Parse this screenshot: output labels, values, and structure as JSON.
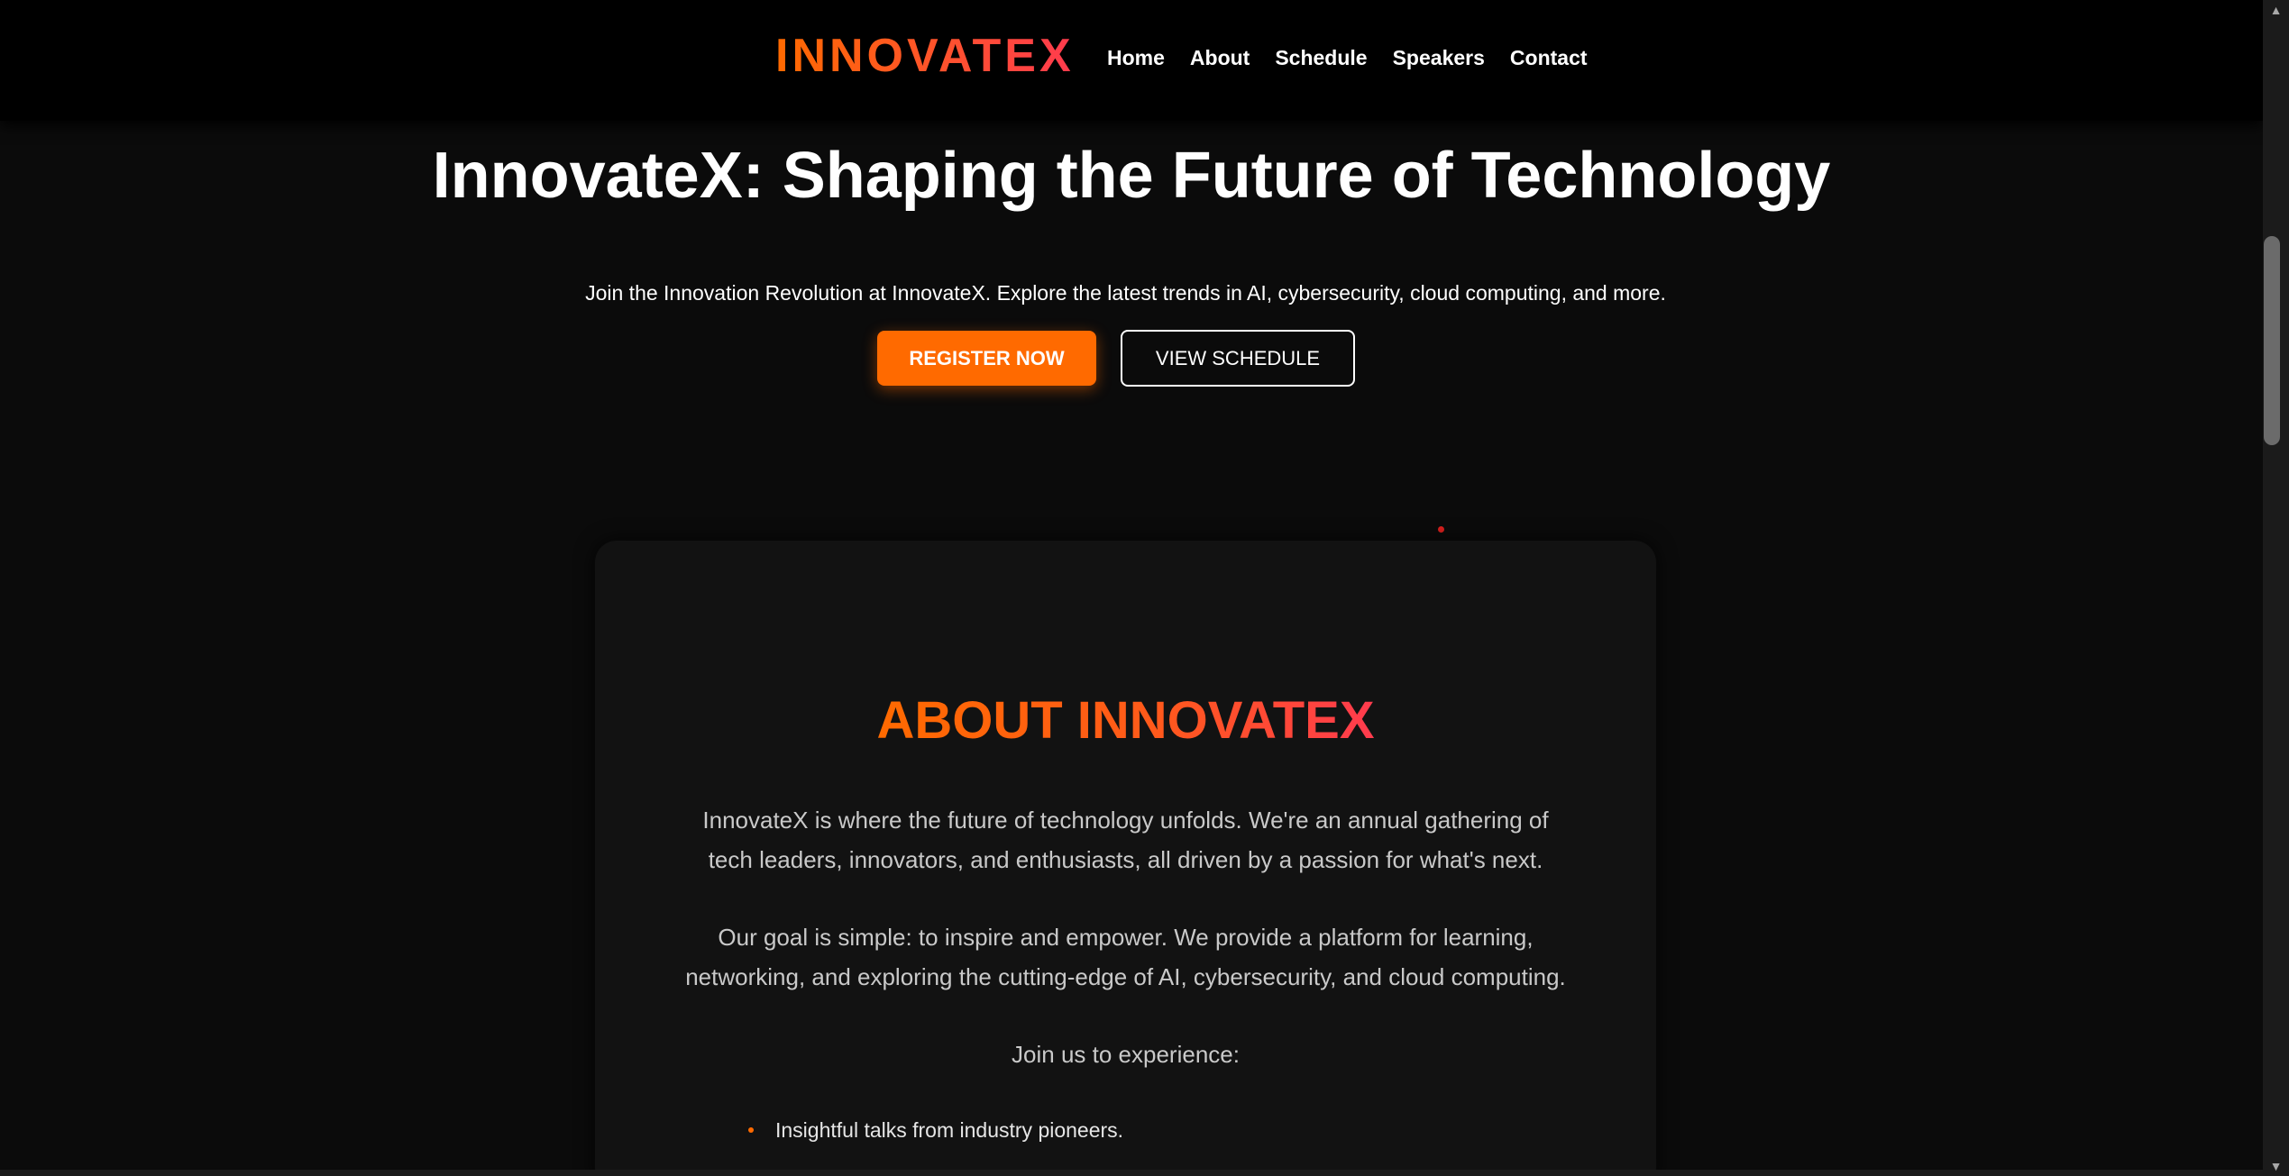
{
  "header": {
    "logo": "INNOVATEX",
    "nav": [
      "Home",
      "About",
      "Schedule",
      "Speakers",
      "Contact"
    ]
  },
  "hero": {
    "title": "InnovateX: Shaping the Future of Technology",
    "subtitle": "Join the Innovation Revolution at InnovateX. Explore the latest trends in AI, cybersecurity, cloud computing, and more.",
    "register_label": "REGISTER NOW",
    "schedule_label": "VIEW SCHEDULE"
  },
  "about": {
    "title": "ABOUT INNOVATEX",
    "p1": "InnovateX is where the future of technology unfolds. We're an annual gathering of tech leaders, innovators, and enthusiasts, all driven by a passion for what's next.",
    "p2": "Our goal is simple: to inspire and empower. We provide a platform for learning, networking, and exploring the cutting-edge of AI, cybersecurity, and cloud computing.",
    "p3": "Join us to experience:",
    "items": [
      "Insightful talks from industry pioneers."
    ]
  },
  "colors": {
    "accent": "#ff6a00",
    "accent_gradient_end": "#ff3b4e",
    "background": "#0b0b0b",
    "card": "#121212"
  }
}
